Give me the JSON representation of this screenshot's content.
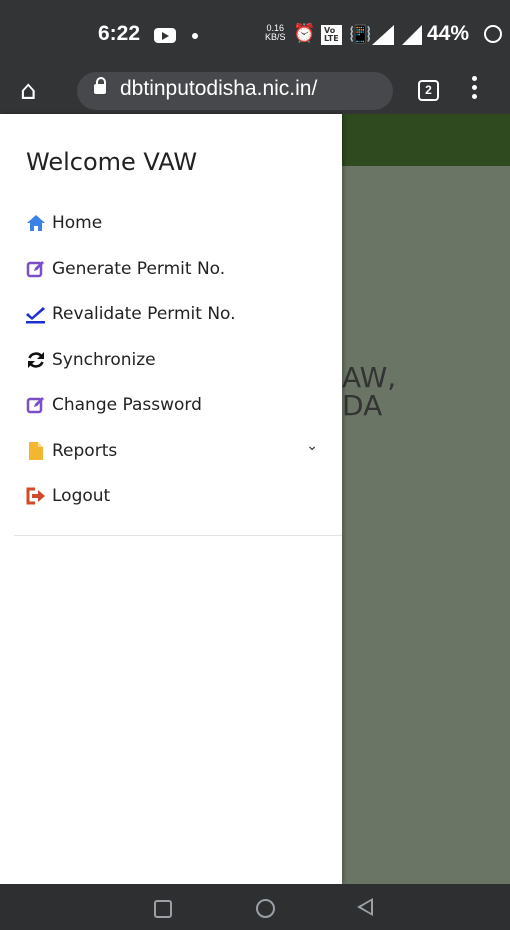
{
  "status": {
    "time": "6:22",
    "speed_value": "0.16",
    "speed_unit": "KB/S",
    "volte_line1": "Vo",
    "volte_line2": "LTE",
    "network": "4G",
    "battery": "44%"
  },
  "browser": {
    "url": "dbtinputodisha.nic.in/",
    "tab_count": "2"
  },
  "page": {
    "line1": "AW,",
    "line2": "DA"
  },
  "drawer": {
    "welcome": "Welcome VAW",
    "items": [
      {
        "label": "Home",
        "icon": "home-icon",
        "color": "#3b82e6"
      },
      {
        "label": "Generate Permit No.",
        "icon": "edit-icon",
        "color": "#7b4fc8"
      },
      {
        "label": "Revalidate Permit No.",
        "icon": "check-icon",
        "color": "#1d2fd1"
      },
      {
        "label": "Synchronize",
        "icon": "sync-icon",
        "color": "#111111"
      },
      {
        "label": "Change Password",
        "icon": "edit-icon",
        "color": "#7b4fc8"
      },
      {
        "label": "Reports",
        "icon": "file-icon",
        "color": "#f2b632"
      },
      {
        "label": "Logout",
        "icon": "logout-icon",
        "color": "#d04a2a"
      }
    ]
  }
}
